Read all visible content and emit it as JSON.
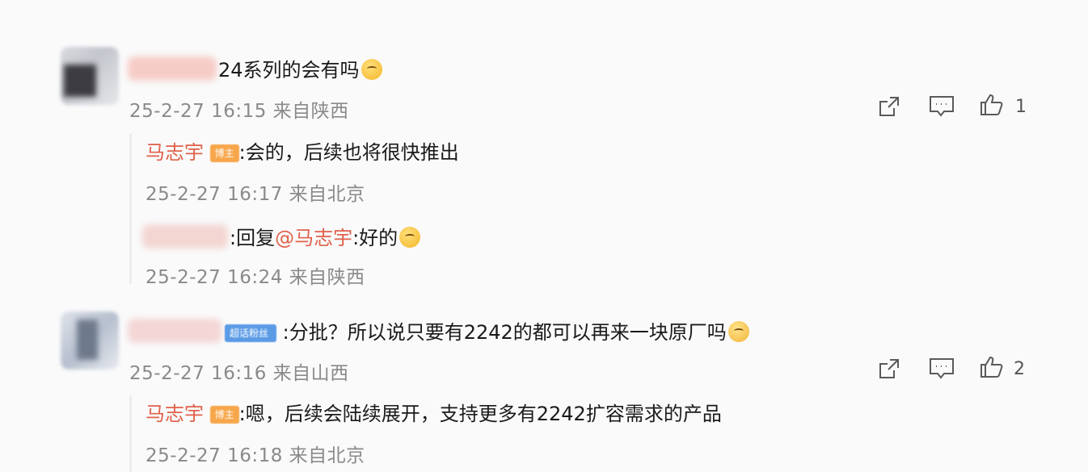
{
  "comments": [
    {
      "text": "24系列的会有吗",
      "meta": "25-2-27 16:15 来自陕西",
      "like_count": "1",
      "replies": [
        {
          "author": "马志宇",
          "badge": "博主",
          "text": ":会的，后续也将很快推出",
          "meta": "25-2-27 16:17 来自北京"
        },
        {
          "prefix": ":回复",
          "mention": "@马志宇",
          "text": ":好的",
          "meta": "25-2-27 16:24 来自陕西"
        }
      ]
    },
    {
      "badge": "超话粉丝",
      "text": ":分批？所以说只要有2242的都可以再来一块原厂吗",
      "meta": "25-2-27 16:16 来自山西",
      "like_count": "2",
      "replies": [
        {
          "author": "马志宇",
          "badge": "博主",
          "text": ":嗯，后续会陆续展开，支持更多有2242扩容需求的产品",
          "meta": "25-2-27 16:18 来自北京"
        }
      ]
    }
  ],
  "icons": {
    "share": "share-icon",
    "comment": "comment-icon",
    "like": "thumbs-up-icon",
    "emoji": "emoji-icon"
  }
}
